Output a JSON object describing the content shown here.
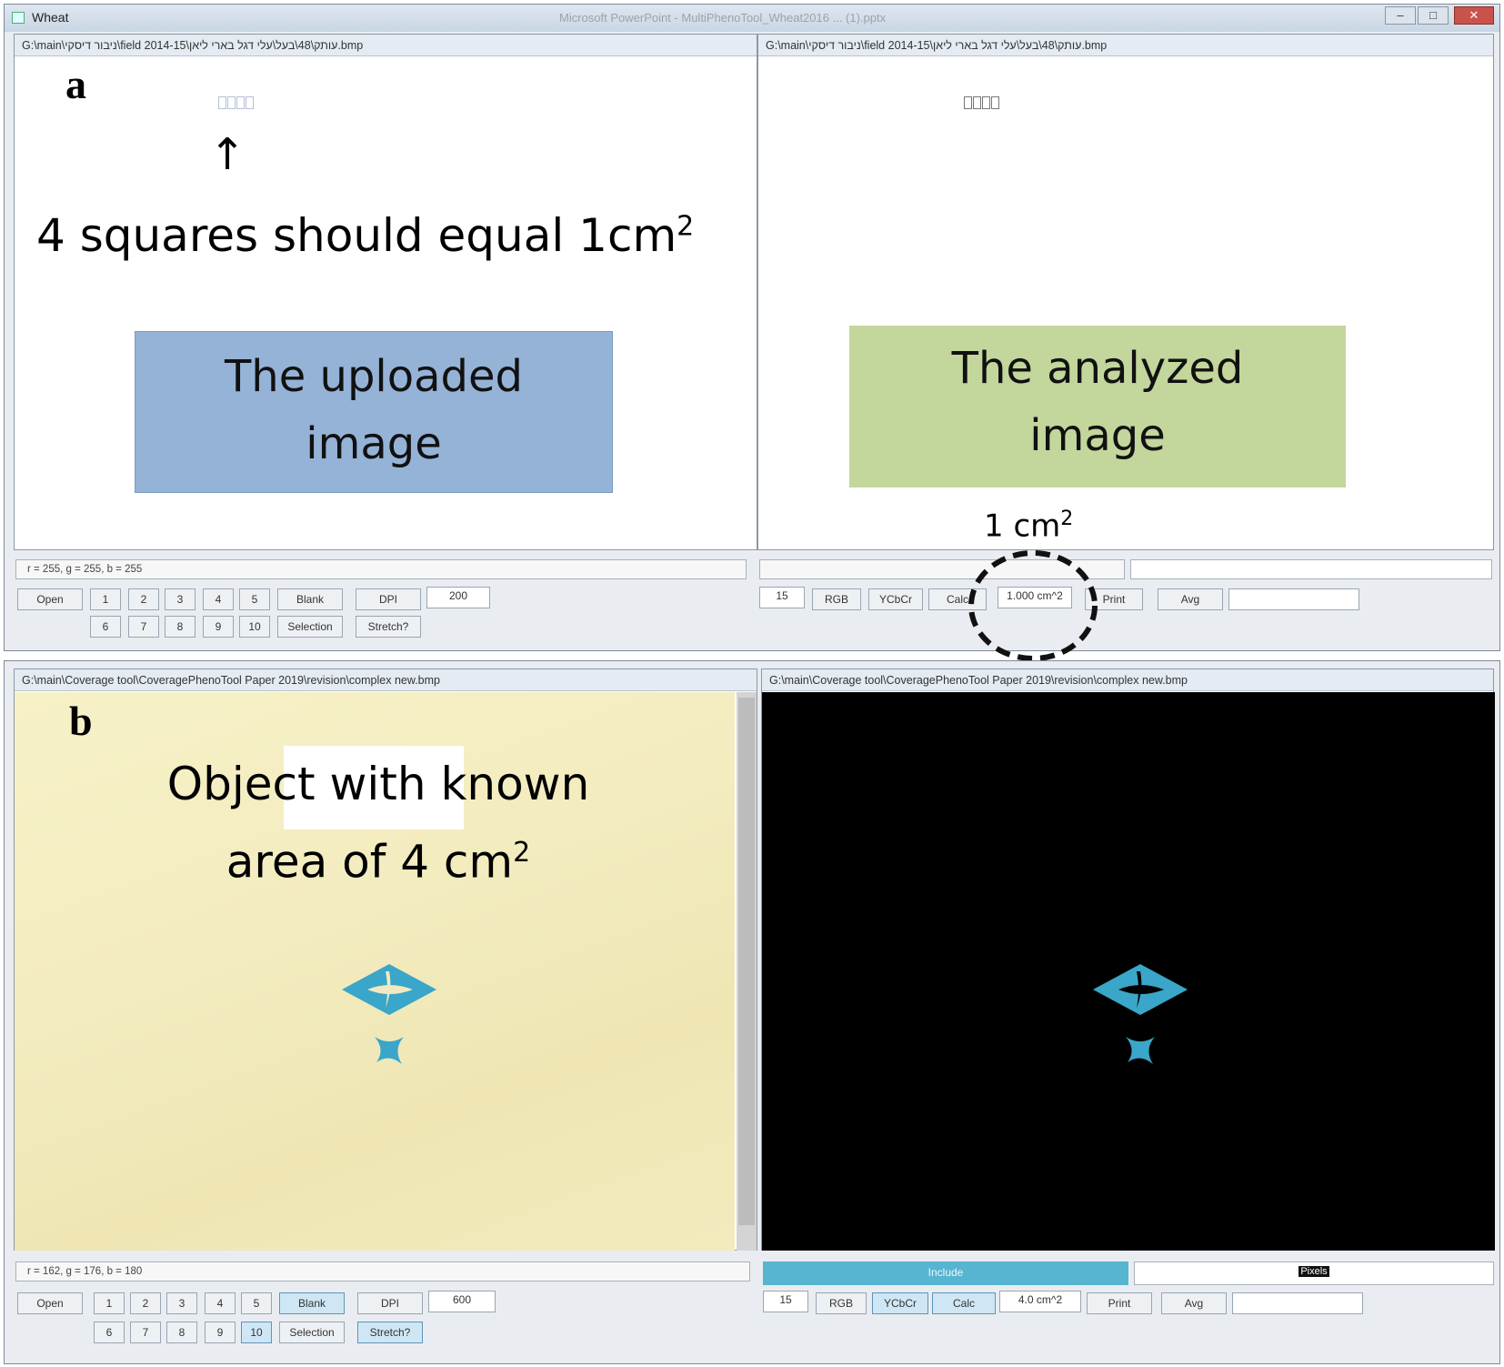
{
  "panel_a": {
    "letter": "a",
    "app_title": "Wheat",
    "bg_window_title": "Microsoft PowerPoint - MultiPhenoTool_Wheat2016 ... (1).pptx",
    "window_controls": [
      "–",
      "□",
      "✕"
    ],
    "left": {
      "path": "G:\\main\\ניבור דיסקי\\field 2014-15\\עותק\\48\\בעל\\עלי דגל בארי ליאן.bmp",
      "arrow": "↑",
      "note_text": "4 squares should equal 1cm",
      "note_sup": "2",
      "callout_line1": "The uploaded",
      "callout_line2": "image",
      "status": "r = 255, g = 255, b = 255",
      "open_label": "Open",
      "row1": [
        "1",
        "2",
        "3",
        "4",
        "5"
      ],
      "row2": [
        "6",
        "7",
        "8",
        "9",
        "10"
      ],
      "blank_label": "Blank",
      "selection_label": "Selection",
      "dpi_label": "DPI",
      "dpi_value": "200",
      "stretch_label": "Stretch?"
    },
    "right": {
      "path": "G:\\main\\ניבור דיסקי\\field 2014-15\\עותק\\48\\בעל\\עלי דגל בארי ליאן.bmp",
      "callout_line1": "The analyzed",
      "callout_line2": "image",
      "unit_label": "1 cm",
      "unit_sup": "2",
      "threshold": "15",
      "rgb_label": "RGB",
      "ycbcr_label": "YCbCr",
      "calc_label": "Calc",
      "area_value": "1.000 cm^2",
      "print_label": "Print",
      "avg_label": "Avg"
    }
  },
  "panel_b": {
    "letter": "b",
    "left": {
      "path": "G:\\main\\Coverage tool\\CoveragePhenoTool  Paper 2019\\revision\\complex new.bmp",
      "note_line1": "Object with known",
      "note_line2_pre": "area of  4 cm",
      "note_sup": "2",
      "status": "r = 162, g = 176, b = 180",
      "open_label": "Open",
      "row1": [
        "1",
        "2",
        "3",
        "4",
        "5"
      ],
      "row2": [
        "6",
        "7",
        "8",
        "9",
        "10"
      ],
      "blank_label": "Blank",
      "selection_label": "Selection",
      "dpi_label": "DPI",
      "dpi_value": "600",
      "stretch_label": "Stretch?"
    },
    "right": {
      "path": "G:\\main\\Coverage tool\\CoveragePhenoTool  Paper 2019\\revision\\complex new.bmp",
      "include_label": "Include",
      "box_label": "Pixels",
      "threshold": "15",
      "rgb_label": "RGB",
      "ycbcr_label": "YCbCr",
      "calc_label": "Calc",
      "area_value": "4.0 cm^2",
      "print_label": "Print",
      "avg_label": "Avg"
    }
  },
  "colors": {
    "uploaded_box": "#95b3d7",
    "analyzed_box": "#c3d69b",
    "object_blue": "#3aa6c9",
    "paper_yellow": "#f4edc2"
  }
}
